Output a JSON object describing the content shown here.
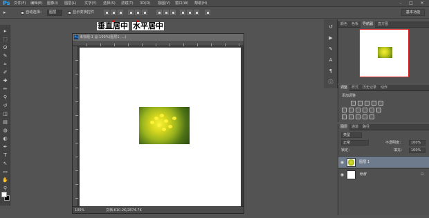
{
  "app": {
    "logo": "Ps"
  },
  "menu": [
    "文件(F)",
    "编辑(E)",
    "图像(I)",
    "图层(L)",
    "文字(Y)",
    "选择(S)",
    "滤镜(T)",
    "3D(D)",
    "视图(V)",
    "窗口(W)",
    "帮助(H)"
  ],
  "window_controls": {
    "minimize": "–",
    "restore": "□",
    "close": "✕"
  },
  "options": {
    "auto_select_label": "自动选择：",
    "auto_select_value": "图层",
    "show_transform_label": "显示变换控件",
    "workspace": "基本功能"
  },
  "annotations": {
    "vertical_center": "垂直居中",
    "horizontal_center": "水平居中",
    "arrow_color": "#e01010"
  },
  "tools": [
    "move-icon",
    "marquee-icon",
    "lasso-icon",
    "quick-select-icon",
    "crop-icon",
    "eyedropper-icon",
    "healing-icon",
    "brush-icon",
    "stamp-icon",
    "history-brush-icon",
    "eraser-icon",
    "gradient-icon",
    "blur-icon",
    "dodge-icon",
    "pen-icon",
    "type-icon",
    "path-select-icon",
    "shape-icon",
    "hand-icon",
    "zoom-icon"
  ],
  "tool_glyphs": [
    "▸",
    "⬚",
    "ʘ",
    "✎",
    "⌗",
    "✐",
    "✚",
    "✏",
    "⚲",
    "↺",
    "◫",
    "▤",
    "◍",
    "◐",
    "✒",
    "T",
    "↖",
    "▭",
    "✋",
    "⚲"
  ],
  "document": {
    "title": "未标题-1 @ 100%(图层1, ...)",
    "ps_icon": "Ps",
    "zoom": "100%",
    "size": "文档:610.2K/2874.7K"
  },
  "right_strip_icons": [
    "history-icon",
    "actions-icon",
    "brush-presets-icon",
    "character-icon",
    "paragraph-icon",
    "info-icon"
  ],
  "navigator_panel": {
    "tabs": [
      "颜色",
      "色板",
      "导航器",
      "直方图"
    ],
    "active_tab": 2
  },
  "adjustments_panel": {
    "tabs": [
      "调整",
      "样式",
      "历史记录",
      "动作"
    ],
    "active_tab": 0,
    "title": "添加调整"
  },
  "layers_panel": {
    "tabs": [
      "图层",
      "通道",
      "路径"
    ],
    "active_tab": 0,
    "filter": "类型",
    "blend_mode": "正常",
    "opacity_label": "不透明度：",
    "opacity_value": "100%",
    "lock_label": "锁定：",
    "fill_label": "填充：",
    "fill_value": "100%",
    "layers": [
      {
        "name": "图层 1",
        "selected": true,
        "thumb": "image"
      },
      {
        "name": "背景",
        "selected": false,
        "thumb": "white",
        "locked": true
      }
    ]
  }
}
